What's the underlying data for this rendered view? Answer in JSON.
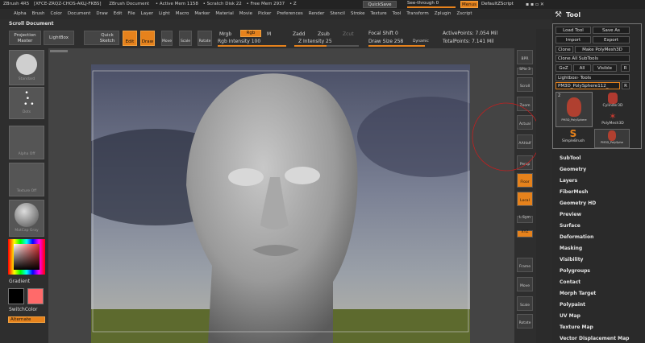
{
  "titlebar": {
    "app": "ZBrush 4R5",
    "serial": "[XFCE-ZRQZ-CHOS-AKLJ-FKBS]",
    "doc": "ZBrush Document",
    "active_mem": "• Active Mem 1158",
    "scratch": "• Scratch Disk 22",
    "free_mem": "• Free Mem 2937",
    "z": "• Z",
    "quicksave": "QuickSave",
    "seethrough": "See-through",
    "seethrough_val": "0",
    "menus": "Menus",
    "script": "DefaultZScript"
  },
  "menu": [
    "Alpha",
    "Brush",
    "Color",
    "Document",
    "Draw",
    "Edit",
    "File",
    "Layer",
    "Light",
    "Macro",
    "Marker",
    "Material",
    "Movie",
    "Picker",
    "Preferences",
    "Render",
    "Stencil",
    "Stroke",
    "Texture",
    "Tool",
    "Transform",
    "Zplugin",
    "Zscript"
  ],
  "scroll_document": "Scroll Document",
  "topshelf": {
    "projection_master": "Projection Master",
    "lightbox": "LightBox",
    "quick_sketch": "Quick Sketch",
    "edit": "Edit",
    "draw": "Draw",
    "move": "Move",
    "scale": "Scale",
    "rotate": "Rotate",
    "mrgb": "Mrgb",
    "rgb": "Rgb",
    "m": "M",
    "rgb_intensity": "Rgb Intensity 100",
    "zadd": "Zadd",
    "zsub": "Zsub",
    "zcut": "Zcut",
    "z_intensity": "Z Intensity 25",
    "focal_shift": "Focal Shift 0",
    "draw_size": "Draw Size 258",
    "dynamic": "Dynamic",
    "active_points": "ActivePoints: 7.054 Mil",
    "total_points": "TotalPoints: 7.141 Mil"
  },
  "leftshelf": {
    "standard": "Standard",
    "dots": "Dots",
    "alpha_off": "Alpha Off",
    "texture_off": "Texture Off",
    "matcap": "MatCap Gray",
    "gradient": "Gradient",
    "switchcolor": "SwitchColor",
    "alternate": "Alternate"
  },
  "rightshelf": [
    {
      "name": "bpr",
      "label": "BPR"
    },
    {
      "name": "spix",
      "label": "SPix 3"
    },
    {
      "name": "scroll",
      "label": "Scroll"
    },
    {
      "name": "zoom",
      "label": "Zoom"
    },
    {
      "name": "actual",
      "label": "Actual"
    },
    {
      "name": "aahalf",
      "label": "AAHalf"
    },
    {
      "name": "persp",
      "label": "Persp"
    },
    {
      "name": "floor",
      "label": "Floor"
    },
    {
      "name": "local",
      "label": "Local"
    },
    {
      "name": "lsym",
      "label": "L.Sym"
    },
    {
      "name": "xyz",
      "label": "XYZ"
    },
    {
      "name": "frame",
      "label": "Frame"
    },
    {
      "name": "move",
      "label": "Move"
    },
    {
      "name": "scale",
      "label": "Scale"
    },
    {
      "name": "rotate",
      "label": "Rotate"
    }
  ],
  "tool": {
    "title": "Tool",
    "load_tool": "Load Tool",
    "save_as": "Save As",
    "import": "Import",
    "export": "Export",
    "clone": "Clone",
    "make_polymesh": "Make PolyMesh3D",
    "clone_all": "Clone All SubTools",
    "goz": "GoZ",
    "all": "All",
    "visible": "Visible",
    "r": "R",
    "lightbox_tools": "Lightbox› Tools",
    "current": "PM3D_PolySphere112_",
    "r2": "R",
    "thumb_count": "2",
    "thumbs": [
      "PM3D_PolySphere",
      "Cylinder3D",
      "PolyMesh3D",
      "SimpleBrush",
      "PM3D_PolySphe"
    ],
    "sections": [
      "SubTool",
      "Geometry",
      "Layers",
      "FiberMesh",
      "Geometry HD",
      "Preview",
      "Surface",
      "Deformation",
      "Masking",
      "Visibility",
      "Polygroups",
      "Contact",
      "Morph Target",
      "Polypaint",
      "UV Map",
      "Texture Map",
      "Vector Displacement Map"
    ]
  }
}
